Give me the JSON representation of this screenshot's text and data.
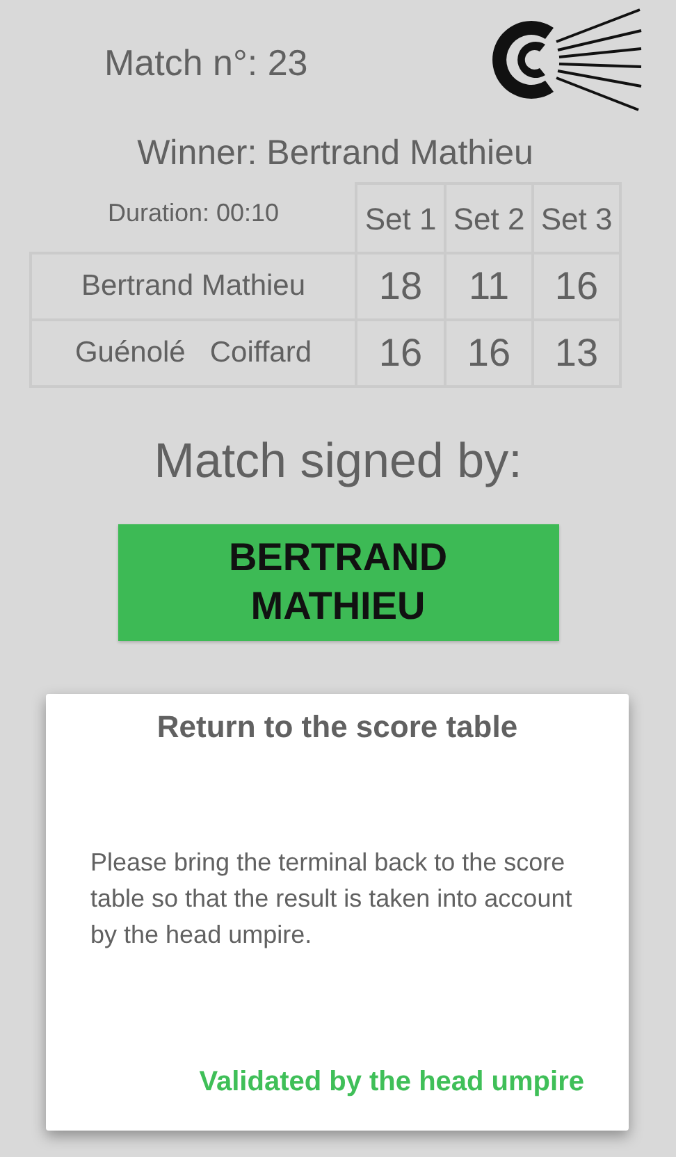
{
  "match_number": "Match n°: 23",
  "winner": "Winner: Bertrand Mathieu",
  "score_table": {
    "duration": "Duration: 00:10",
    "columns": [
      "Set 1",
      "Set 2",
      "Set 3"
    ],
    "rows": [
      {
        "player": "Bertrand Mathieu",
        "scores": [
          "18",
          "11",
          "16"
        ]
      },
      {
        "player": "Guénolé   Coiffard",
        "scores": [
          "16",
          "16",
          "13"
        ]
      }
    ]
  },
  "signed_by_label": "Match signed by:",
  "signer_button": "BERTRAND MATHIEU",
  "dialog": {
    "title": "Return to the score table",
    "message": "Please bring the terminal back to the score table so that the result is taken into account by the head umpire.",
    "action": "Validated by the head umpire"
  }
}
